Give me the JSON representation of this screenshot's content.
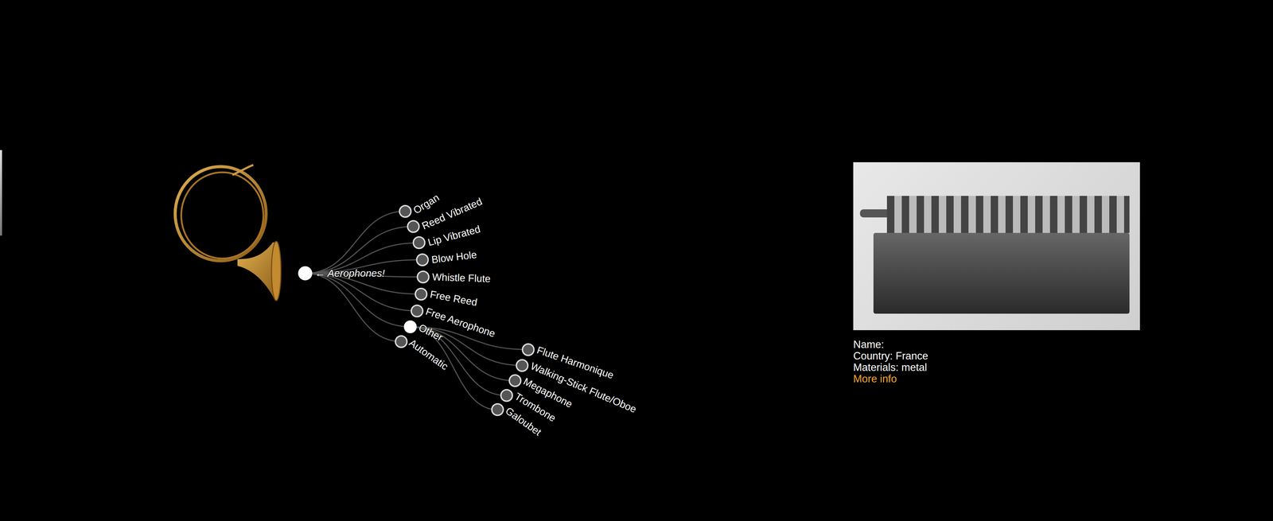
{
  "tree": {
    "root": {
      "label": "← Aerophones!",
      "expanded": true
    },
    "categories": [
      {
        "label": "Organ",
        "expanded": false
      },
      {
        "label": "Reed Vibrated",
        "expanded": false
      },
      {
        "label": "Lip Vibrated",
        "expanded": false
      },
      {
        "label": "Blow Hole",
        "expanded": false
      },
      {
        "label": "Whistle Flute",
        "expanded": false
      },
      {
        "label": "Free Reed",
        "expanded": false
      },
      {
        "label": "Free Aerophone",
        "expanded": false
      },
      {
        "label": "Other",
        "expanded": true
      },
      {
        "label": "Automatic",
        "expanded": false
      }
    ],
    "children": [
      {
        "label": "Flute Harmonique",
        "expanded": false
      },
      {
        "label": "Walking-Stick Flute/Oboe",
        "expanded": false
      },
      {
        "label": "Megaphone",
        "expanded": false
      },
      {
        "label": "Trombone",
        "expanded": false
      },
      {
        "label": "Galoubet",
        "expanded": false
      }
    ]
  },
  "detail": {
    "name": "Name:",
    "country": "Country: France",
    "materials": "Materials: metal",
    "more_info": "More info"
  }
}
